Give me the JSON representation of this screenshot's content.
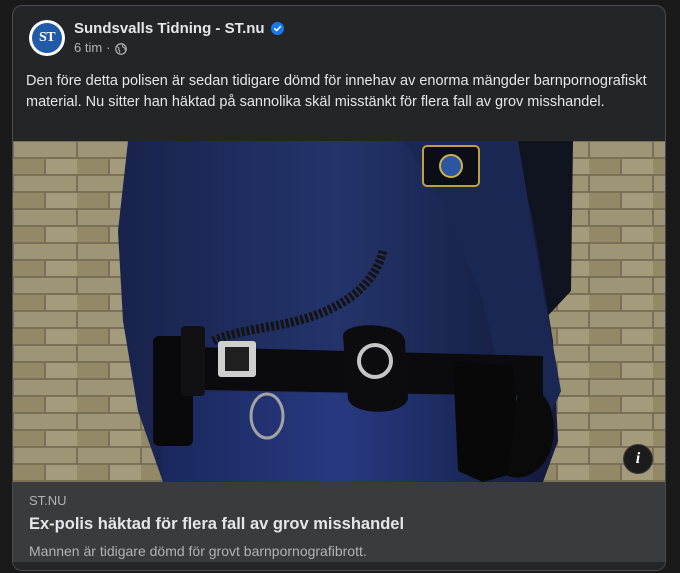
{
  "post": {
    "page_name": "Sundsvalls Tidning - ST.nu",
    "avatar_text": "ST",
    "timestamp": "6 tim",
    "separator": "·",
    "body": "Den före detta polisen är sedan tidigare dömd för innehav av enorma mängder barnpornografiskt material. Nu sitter han häktad på sannolika skäl misstänkt för flera fall av grov misshandel."
  },
  "icons": {
    "verified": "verified-badge-icon",
    "privacy": "globe-icon",
    "info": "info-icon"
  },
  "link": {
    "domain": "ST.NU",
    "title": "Ex-polis häktad för flera fall av grov misshandel",
    "description": "Mannen är tidigare dömd för grovt barnpornografibrott."
  },
  "info_label": "i",
  "colors": {
    "card_bg": "#242526",
    "preview_bg": "#3a3b3c",
    "brand_blue": "#1f5ba8",
    "verified_blue": "#1877f2"
  }
}
